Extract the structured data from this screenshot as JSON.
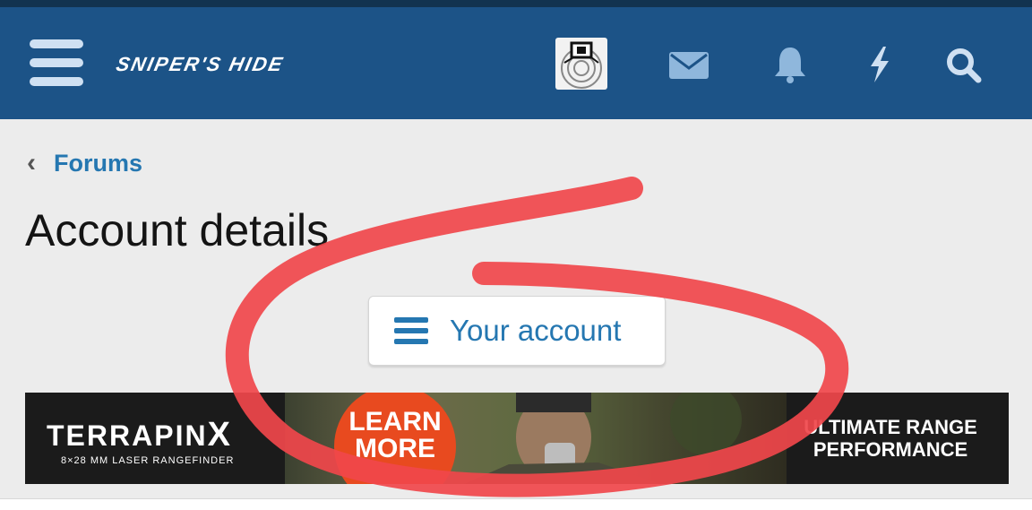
{
  "header": {
    "logo_text": "SNIPER'S HIDE",
    "icons": [
      "menu-icon",
      "avatar",
      "mail-icon",
      "bell-icon",
      "bolt-icon",
      "search-icon"
    ],
    "bg_color": "#1c5387"
  },
  "breadcrumb": {
    "chevron": "‹",
    "link": "Forums"
  },
  "page": {
    "title": "Account details"
  },
  "account_button": {
    "label": "Your account",
    "accent": "#2577b1"
  },
  "banner": {
    "brand": "TERRAPIN",
    "brand_x": "X",
    "subtitle": "8×28 MM LASER RANGEFINDER",
    "cta_line1": "LEARN",
    "cta_line2": "MORE",
    "tagline_line1": "ULTIMATE RANGE",
    "tagline_line2": "PERFORMANCE",
    "cta_color": "#e84a1f"
  },
  "annotation": {
    "color": "#f0474b"
  }
}
